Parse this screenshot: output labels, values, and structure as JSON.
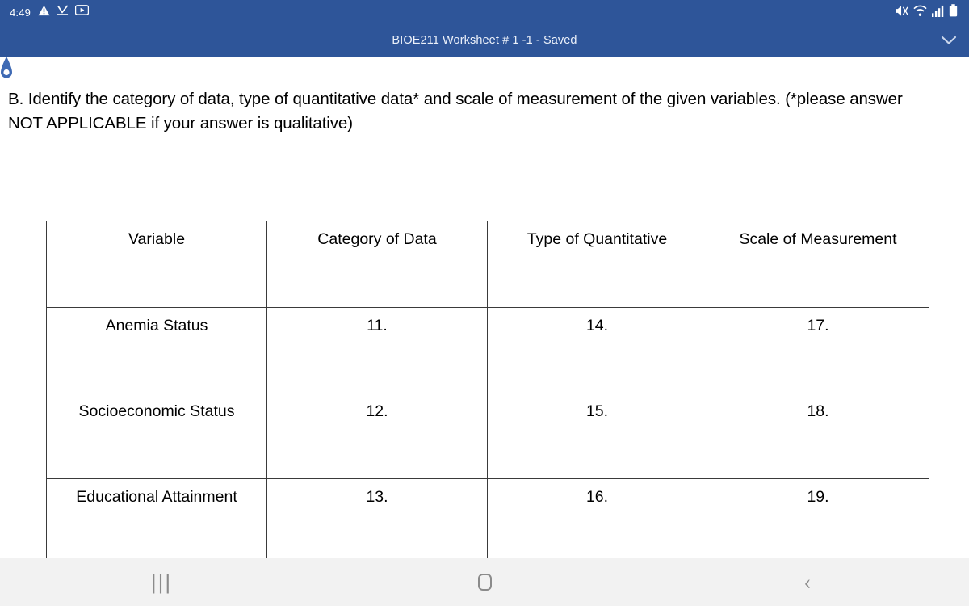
{
  "status_bar": {
    "time": "4:49",
    "left_icons": [
      "warning-triangle-icon",
      "download-check-icon",
      "video-player-icon"
    ],
    "right_icons": [
      "mute-icon",
      "wifi-icon",
      "signal-bars-icon",
      "battery-icon"
    ],
    "background_color": "#2e5599"
  },
  "title_bar": {
    "document_title": "BIOE211 Worksheet # 1 -1 - Saved",
    "expand_icon": "chevron-down-icon",
    "background_color": "#2e5599",
    "title_color": "#ecf1fa"
  },
  "document": {
    "selection_handle_icon": "text-selection-handle-icon",
    "selection_handle_color": "#3f6ab4",
    "instruction": "B. Identify the category of data, type of quantitative data* and scale of measurement of the given variables. (*please answer NOT APPLICABLE if your answer is qualitative)",
    "table": {
      "headers": [
        "Variable",
        "Category of Data",
        "Type of Quantitative",
        "Scale of Measurement"
      ],
      "rows": [
        [
          "Anemia Status",
          "11.",
          "14.",
          "17."
        ],
        [
          "Socioeconomic Status",
          "12.",
          "15.",
          "18."
        ],
        [
          "Educational Attainment",
          "13.",
          "16.",
          "19."
        ]
      ],
      "border_color": "#3a3a3a"
    }
  },
  "keyboard_lock_button": {
    "icon": "lock-keyboard-icon",
    "background_color": "#000000"
  },
  "nav_bar": {
    "recents_label": "|||",
    "recents_icon": "recents-icon",
    "home_icon": "home-icon",
    "back_label": "‹",
    "back_icon": "back-icon",
    "background_color": "#f2f2f2"
  }
}
